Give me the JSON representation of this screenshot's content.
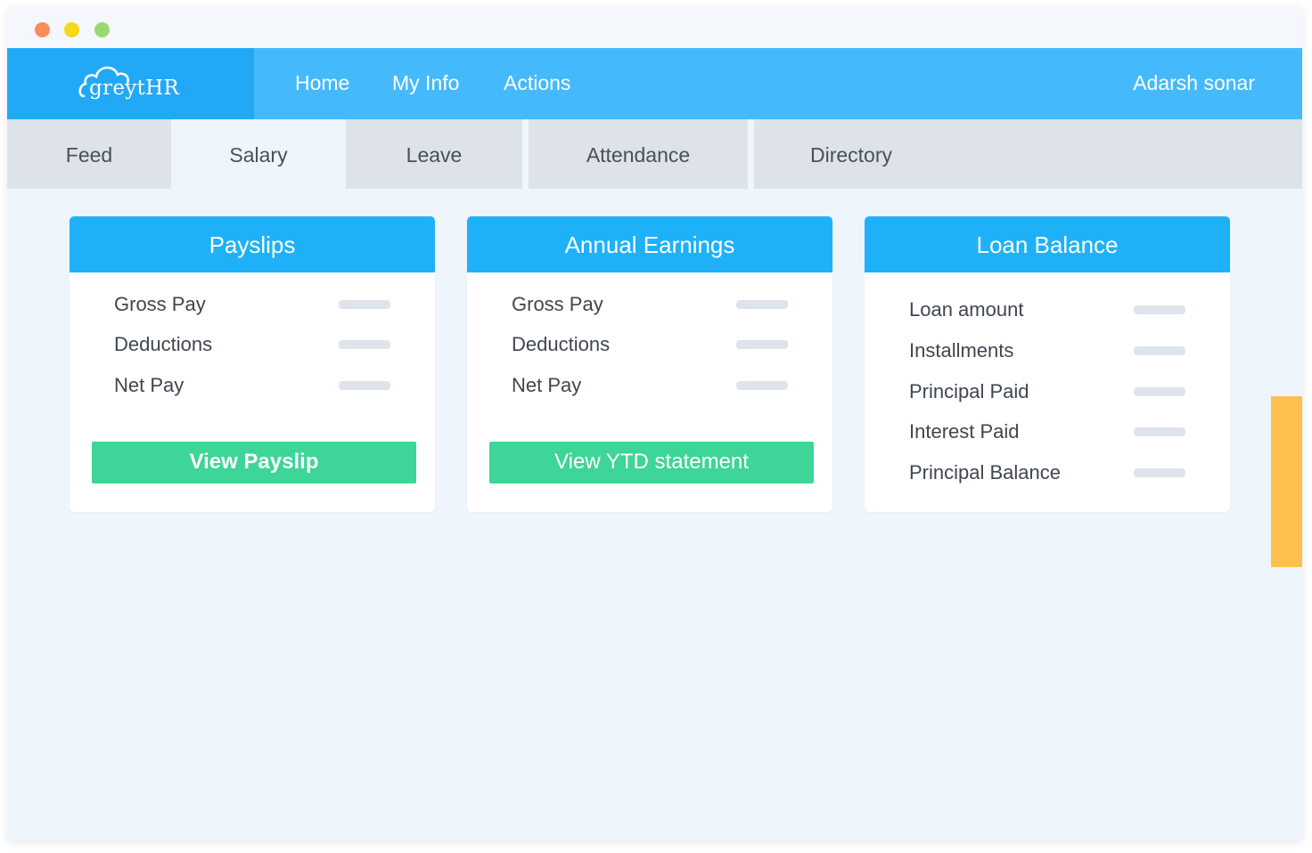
{
  "window": {
    "controls": [
      "close",
      "minimize",
      "maximize"
    ]
  },
  "brand": {
    "logo_text": "greytHR"
  },
  "topnav": {
    "items": [
      {
        "label": "Home"
      },
      {
        "label": "My Info"
      },
      {
        "label": "Actions"
      }
    ],
    "user_name": "Adarsh sonar"
  },
  "tabs": [
    {
      "label": "Feed",
      "active": false
    },
    {
      "label": "Salary",
      "active": true
    },
    {
      "label": "Leave",
      "active": false
    },
    {
      "label": "Attendance",
      "active": false
    },
    {
      "label": "Directory",
      "active": false
    }
  ],
  "cards": {
    "payslips": {
      "title": "Payslips",
      "rows": [
        "Gross Pay",
        "Deductions",
        "Net Pay"
      ],
      "button_label": "View Payslip"
    },
    "annual_earnings": {
      "title": "Annual Earnings",
      "rows": [
        "Gross Pay",
        "Deductions",
        "Net Pay"
      ],
      "button_label": "View YTD statement"
    },
    "loan_balance": {
      "title": "Loan Balance",
      "rows": [
        "Loan amount",
        "Installments",
        "Principal Paid",
        "Interest Paid",
        "Principal Balance"
      ]
    }
  },
  "colors": {
    "nav_bg": "#44bafd",
    "logo_bg": "#22a9f5",
    "card_header": "#1eb1f8",
    "button_green": "#3dd598",
    "side_tab": "#fdc04f"
  },
  "icons": {
    "logo": "cloud-icon",
    "side_tab": "feedback-tab"
  }
}
